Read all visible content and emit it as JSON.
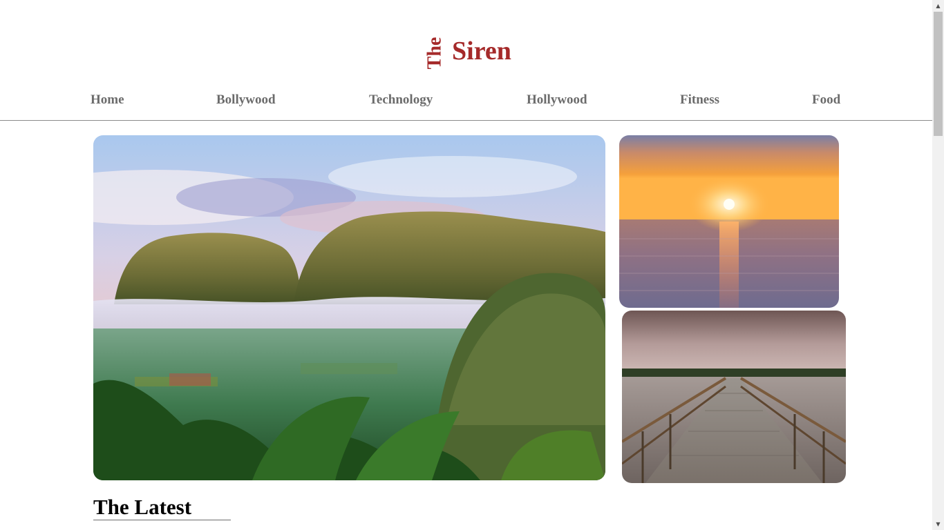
{
  "logo": {
    "the": "The",
    "siren": "Siren"
  },
  "nav": {
    "items": [
      {
        "label": "Home"
      },
      {
        "label": "Bollywood"
      },
      {
        "label": "Technology"
      },
      {
        "label": "Hollywood"
      },
      {
        "label": "Fitness"
      },
      {
        "label": "Food"
      }
    ]
  },
  "gallery": {
    "images": [
      {
        "name": "hero-mountain-valley-image"
      },
      {
        "name": "sunset-sea-image"
      },
      {
        "name": "wooden-bridge-image"
      }
    ]
  },
  "latest": {
    "heading": "The Latest"
  },
  "colors": {
    "brand": "#a52a2a",
    "nav_text": "#6b6b6b",
    "divider": "#8a8a8a"
  }
}
